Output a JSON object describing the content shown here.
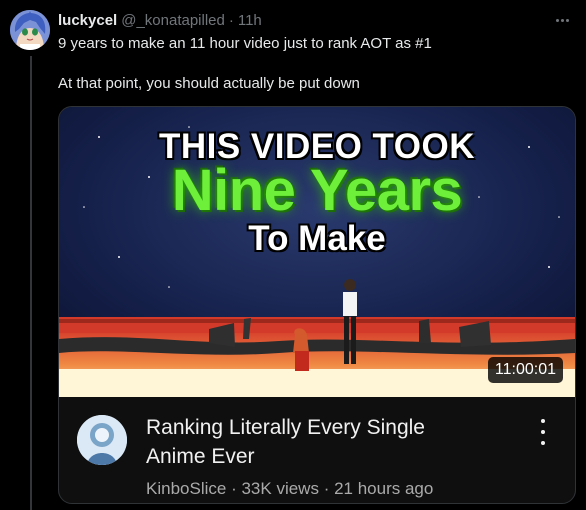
{
  "tweet": {
    "display_name": "luckycel",
    "handle": "@_konatapilled",
    "separator": "·",
    "time": "11h",
    "text_line1": "9 years to make an 11 hour video just to rank AOT as #1",
    "text_line2": "At that point, you should actually be put down"
  },
  "video": {
    "thumbnail_line1": "THIS VIDEO TOOK",
    "thumbnail_line2": "Nine Years",
    "thumbnail_line3": "To Make",
    "duration": "11:00:01",
    "title": "Ranking Literally Every Single Anime Ever",
    "channel": "KinboSlice",
    "views": "33K views",
    "age": "21 hours ago",
    "meta_separator": "·"
  },
  "colors": {
    "background": "#000000",
    "accent_green": "#6ef03a",
    "muted_text": "#71767b"
  },
  "icons": {
    "more": "more-horizontal-icon",
    "kebab": "more-vertical-icon"
  }
}
